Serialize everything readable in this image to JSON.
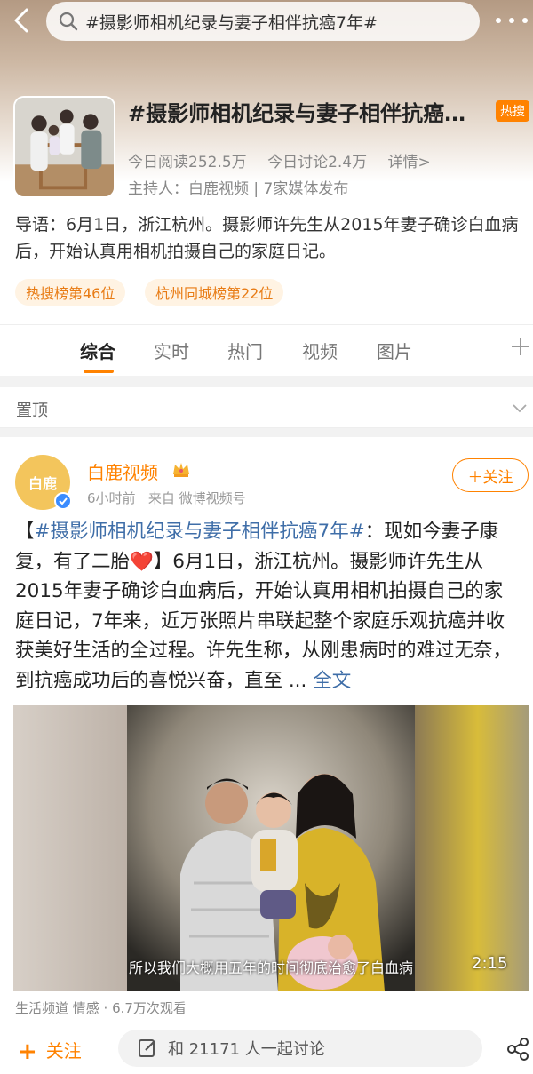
{
  "search": {
    "query": "#摄影师相机纪录与妻子相伴抗癌7年#"
  },
  "topic": {
    "title": "#摄影师相机纪录与妻子相伴抗癌…",
    "badge": "热搜",
    "stats": {
      "reads": "今日阅读252.5万",
      "discussions": "今日讨论2.4万",
      "details": "详情>"
    },
    "host": "主持人：白鹿视频 | 7家媒体发布",
    "guide": "导语：6月1日，浙江杭州。摄影师许先生从2015年妻子确诊白血病后，开始认真用相机拍摄自己的家庭日记。",
    "ranks": [
      "热搜榜第46位",
      "杭州同城榜第22位"
    ]
  },
  "tabs": [
    {
      "label": "综合",
      "active": true
    },
    {
      "label": "实时"
    },
    {
      "label": "热门"
    },
    {
      "label": "视频"
    },
    {
      "label": "图片"
    }
  ],
  "pinned": {
    "label": "置顶"
  },
  "post": {
    "avatar_text": "白鹿",
    "author": "白鹿视频",
    "time": "6小时前",
    "source_prefix": "来自",
    "source": "微博视频号",
    "follow_label": "＋关注",
    "text_prefix": "【",
    "topic_link": "#摄影师相机纪录与妻子相伴抗癌7年#",
    "text_part1": "：现如今妻子康复，有了二胎",
    "heart": "❤️",
    "text_part2": "】6月1日，浙江杭州。摄影师许先生从2015年妻子确诊白血病后，开始认真用相机拍摄自己的家庭日记，7年来，近万张照片串联起整个家庭乐观抗癌并收获美好生活的全过程。许先生称，从刚患病时的难过无奈，到抗癌成功后的喜悦兴奋，直至 ... ",
    "more_link": "全文",
    "video": {
      "subtitle": "所以我们大概用五年的时间彻底治愈了白血病",
      "duration": "2:15",
      "info": "生活频道 情感 · 6.7万次观看"
    }
  },
  "bottom": {
    "follow_label": "关注",
    "discuss_label": "和 21171 人一起讨论"
  },
  "colors": {
    "accent": "#ff8200",
    "link": "#3f6ea8"
  }
}
